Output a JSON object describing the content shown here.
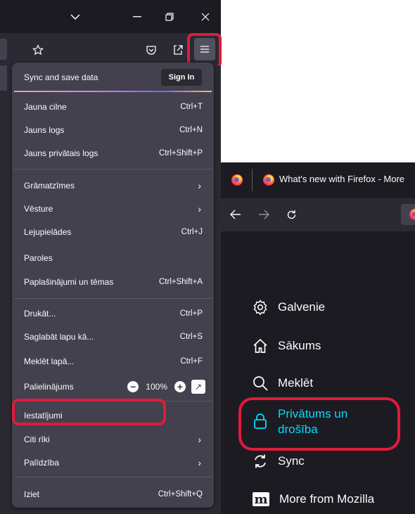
{
  "menu": {
    "sync": {
      "label": "Sync and save data",
      "signin": "Sign In"
    },
    "items": [
      {
        "label": "Jauna cilne",
        "shortcut": "Ctrl+T"
      },
      {
        "label": "Jauns logs",
        "shortcut": "Ctrl+N"
      },
      {
        "label": "Jauns privātais logs",
        "shortcut": "Ctrl+Shift+P"
      },
      {
        "label": "Grāmatzīmes",
        "shortcut": ""
      },
      {
        "label": "Vēsture",
        "shortcut": ""
      },
      {
        "label": "Lejupielādes",
        "shortcut": "Ctrl+J"
      },
      {
        "label": "Paroles",
        "shortcut": ""
      },
      {
        "label": "Paplašinājumi un tēmas",
        "shortcut": "Ctrl+Shift+A"
      },
      {
        "label": "Drukāt...",
        "shortcut": "Ctrl+P"
      },
      {
        "label": "Saglabāt lapu kā...",
        "shortcut": "Ctrl+S"
      },
      {
        "label": "Meklēt lapā...",
        "shortcut": "Ctrl+F"
      },
      {
        "label": "Iestatījumi",
        "shortcut": ""
      },
      {
        "label": "Citi rīki",
        "shortcut": ""
      },
      {
        "label": "Palīdzība",
        "shortcut": ""
      },
      {
        "label": "Iziet",
        "shortcut": "Ctrl+Shift+Q"
      }
    ],
    "zoom": {
      "label": "Palielinājums",
      "value": "100%"
    }
  },
  "settings_window": {
    "tab_title": "What's new with Firefox - More",
    "categories": [
      {
        "label": "Galvenie",
        "icon": "gear-icon"
      },
      {
        "label": "Sākums",
        "icon": "home-icon"
      },
      {
        "label": "Meklēt",
        "icon": "search-icon"
      },
      {
        "label": "Privātums un",
        "label2": "drošība",
        "icon": "lock-icon"
      },
      {
        "label": "Sync",
        "icon": "sync-icon"
      },
      {
        "label": "More from Mozilla",
        "icon": "mozilla-m-icon"
      }
    ]
  },
  "colors": {
    "highlight": "#e01b3c",
    "menu_bg": "#42414d",
    "active_category": "#00ddff"
  }
}
